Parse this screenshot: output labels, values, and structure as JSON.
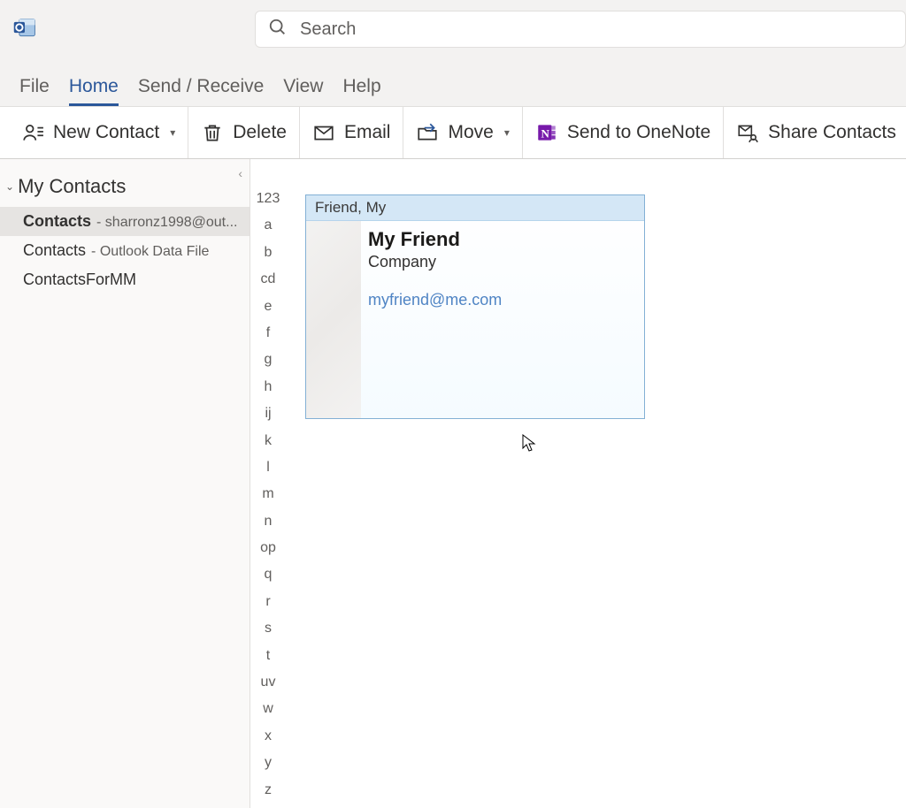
{
  "search": {
    "placeholder": "Search"
  },
  "menu": {
    "file": "File",
    "home": "Home",
    "send_receive": "Send / Receive",
    "view": "View",
    "help": "Help"
  },
  "ribbon": {
    "new_contact": "New Contact",
    "delete": "Delete",
    "email": "Email",
    "move": "Move",
    "send_onenote": "Send to OneNote",
    "share_contacts": "Share Contacts"
  },
  "sidebar": {
    "header": "My Contacts",
    "items": [
      {
        "primary": "Contacts",
        "secondary": "- sharronz1998@out..."
      },
      {
        "primary": "Contacts",
        "secondary": "- Outlook Data File"
      },
      {
        "primary": "ContactsForMM",
        "secondary": ""
      }
    ]
  },
  "alpha_index": [
    "123",
    "a",
    "b",
    "cd",
    "e",
    "f",
    "g",
    "h",
    "ij",
    "k",
    "l",
    "m",
    "n",
    "op",
    "q",
    "r",
    "s",
    "t",
    "uv",
    "w",
    "x",
    "y",
    "z"
  ],
  "contact_card": {
    "header": "Friend, My",
    "name": "My Friend",
    "company": "Company",
    "email": "myfriend@me.com"
  }
}
